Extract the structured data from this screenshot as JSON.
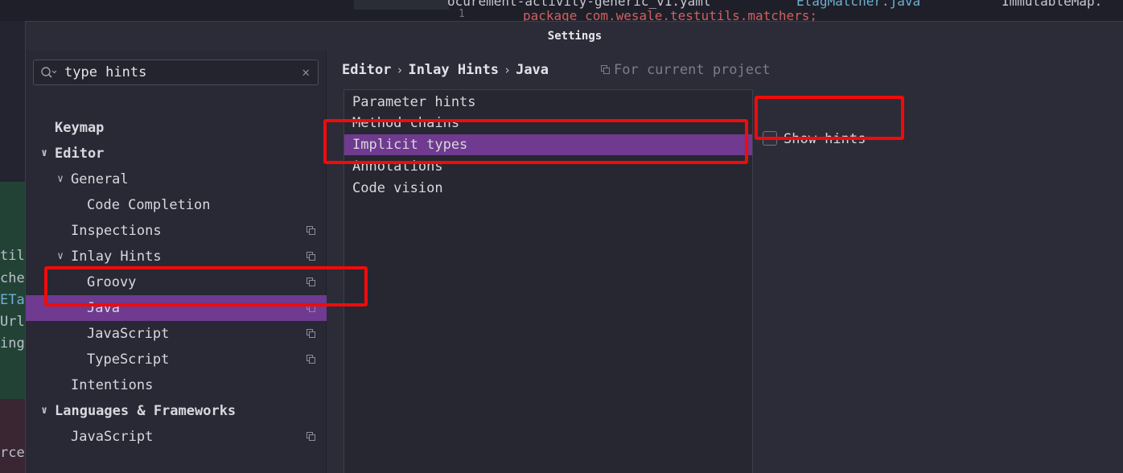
{
  "background": {
    "tab_text_1": "ocurement-activity-generic_v1.yaml",
    "tab_text_2": "EtagMatcher.java",
    "tab_text_3": "ImmutableMap.",
    "line_number": "1",
    "code_line": "package com.wesale.testutils.matchers;",
    "fragments": [
      "til",
      "che",
      "ETag",
      "UrlM",
      "ing",
      "rce"
    ]
  },
  "dialog": {
    "title": "Settings",
    "search": {
      "value": "type hints"
    },
    "tree": [
      {
        "label": "Keymap"
      },
      {
        "label": "Editor"
      },
      {
        "label": "General"
      },
      {
        "label": "Code Completion"
      },
      {
        "label": "Inspections"
      },
      {
        "label": "Inlay Hints"
      },
      {
        "label": "Groovy"
      },
      {
        "label": "Java"
      },
      {
        "label": "JavaScript"
      },
      {
        "label": "TypeScript"
      },
      {
        "label": "Intentions"
      },
      {
        "label": "Languages & Frameworks"
      },
      {
        "label": "JavaScript"
      }
    ],
    "breadcrumb": [
      "Editor",
      "Inlay Hints",
      "Java"
    ],
    "breadcrumb_sep": "›",
    "scope_label": "For current project",
    "hint_types": [
      "Parameter hints",
      "Method chains",
      "Implicit types",
      "Annotations",
      "Code vision"
    ],
    "selected_hint_type": "Implicit types",
    "show_hints": {
      "label": "Show hints",
      "checked": false
    }
  },
  "colors": {
    "selection": "#6f3a8f",
    "annotation": "#f20a0a"
  }
}
